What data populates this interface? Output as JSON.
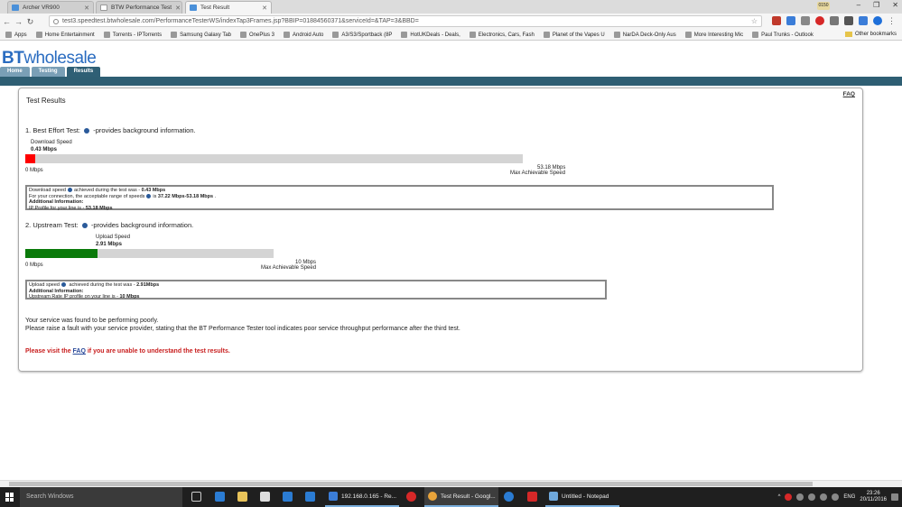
{
  "browser": {
    "tabs": [
      {
        "label": "Archer VR900",
        "active": false
      },
      {
        "label": "BTW Performance Test",
        "active": false
      },
      {
        "label": "Test Result",
        "active": true
      }
    ],
    "user_chip": "0150",
    "window_controls": {
      "minimize": "–",
      "maximize": "❐",
      "close": "✕"
    },
    "url": "test3.speedtest.btwholesale.com/PerformanceTesterWS/indexTap3Frames.jsp?BBIP=01884560371&serviceId=&TAP=3&BBD=",
    "bookmarks": [
      "Apps",
      "Home Entertainment",
      "Torrents - IPTorrents",
      "Samsung Galaxy Tab",
      "OnePlus 3",
      "Android Auto",
      "A3/S3/Sportback (8P",
      "HotUKDeals - Deals,",
      "Electronics, Cars, Fash",
      "Planet of the Vapes U",
      "NarDA Deck-Only Aus",
      "More Interesting Mic",
      "Paul Trunks - Outlook"
    ],
    "other_bookmarks": "Other bookmarks"
  },
  "bt": {
    "logo_bt": "BT",
    "logo_ws": "wholesale",
    "nav": [
      {
        "label": "Home",
        "selected": false
      },
      {
        "label": "Testing",
        "selected": false
      },
      {
        "label": "Results",
        "selected": true
      }
    ]
  },
  "results": {
    "faq": "FAQ",
    "title": "Test Results",
    "best_effort": {
      "heading_pre": "1. Best Effort Test:",
      "heading_post": "-provides background information.",
      "speed_label": "Download Speed",
      "speed_value": "0.43 Mbps",
      "min_label": "0 Mbps",
      "max_value": "53.18 Mbps",
      "max_label": "Max Achievable Speed",
      "fill_fraction": 0.0081,
      "bar_color": "#ff0000",
      "info": {
        "line1_pre": "Download speed",
        "line1_mid": "achieved during the test was - ",
        "line1_val": "0.43 Mbps",
        "line2_pre": "For your connection, the acceptable range of speeds",
        "line2_mid": "is ",
        "line2_val": "37.22 Mbps-53.18 Mbps",
        "line2_post": " .",
        "line3": "Additional Information:",
        "line4_pre": "IP Profile for your line is - ",
        "line4_val": "53.18 Mbps"
      }
    },
    "upstream": {
      "heading_pre": "2. Upstream Test:",
      "heading_post": "-provides background information.",
      "speed_label": "Upload Speed",
      "speed_value": "2.91 Mbps",
      "min_label": "0 Mbps",
      "max_value": "10 Mbps",
      "max_label": "Max Achievable Speed",
      "fill_fraction": 0.291,
      "bar_color": "#0a7a0a",
      "info": {
        "line1_pre": "Upload speed",
        "line1_mid": " achieved during the test was - ",
        "line1_val": "2.91Mbps",
        "line2": "Additional Information:",
        "line3_pre": "Upstream Rate IP profile on your line is - ",
        "line3_val": "10 Mbps"
      }
    },
    "message1": "Your service was found to be performing poorly.",
    "message2": "Please raise a fault with your service provider, stating that the BT Performance Tester tool indicates poor service throughput performance after the third test.",
    "error_pre": "Please visit the ",
    "error_link": "FAQ",
    "error_post": " if you are unable to understand the test results."
  },
  "taskbar": {
    "search_placeholder": "Search Windows",
    "apps": [
      {
        "label": "192.168.0.165 - Re...",
        "active": false
      },
      {
        "label": "Test Result - Googl...",
        "active": true
      },
      {
        "label": "Untitled - Notepad",
        "active": false
      }
    ],
    "language": "ENG",
    "time": "23:26",
    "date": "20/11/2016"
  }
}
